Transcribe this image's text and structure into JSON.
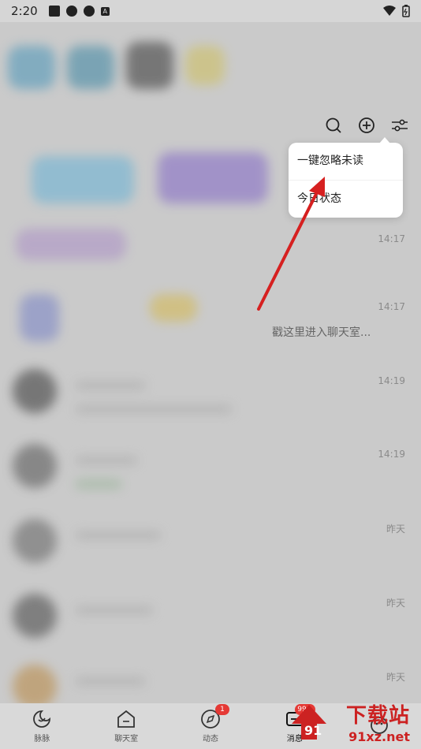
{
  "status_bar": {
    "time": "2:20",
    "icons": [
      "square-icon",
      "aperture-icon",
      "aperture-icon",
      "a-box-icon"
    ],
    "right_icons": [
      "wifi-icon",
      "battery-icon"
    ]
  },
  "header": {
    "icons": [
      "search-icon",
      "add-circle-icon",
      "filter-sliders-icon"
    ]
  },
  "popup_menu": {
    "items": [
      {
        "label": "一键忽略未读"
      },
      {
        "label": "今日状态"
      }
    ]
  },
  "conversation_list": {
    "times": [
      "14:17",
      "14:17",
      "14:19",
      "14:19",
      "昨天",
      "昨天",
      "昨天"
    ],
    "preview_text": "戳这里进入聊天室..."
  },
  "bottom_nav": {
    "items": [
      {
        "label": "脉脉",
        "icon": "moon-swirl-icon"
      },
      {
        "label": "聊天室",
        "icon": "chatroom-icon"
      },
      {
        "label": "动态",
        "icon": "compass-icon",
        "badge": "1"
      },
      {
        "label": "消息",
        "icon": "message-icon",
        "badge": "99+"
      },
      {
        "label": "",
        "icon": "profile-icon"
      }
    ]
  },
  "watermark": {
    "brand": "下载站",
    "url": "91xz.net"
  },
  "colors": {
    "accent_red": "#e53935",
    "annotation_arrow": "#d62020"
  }
}
